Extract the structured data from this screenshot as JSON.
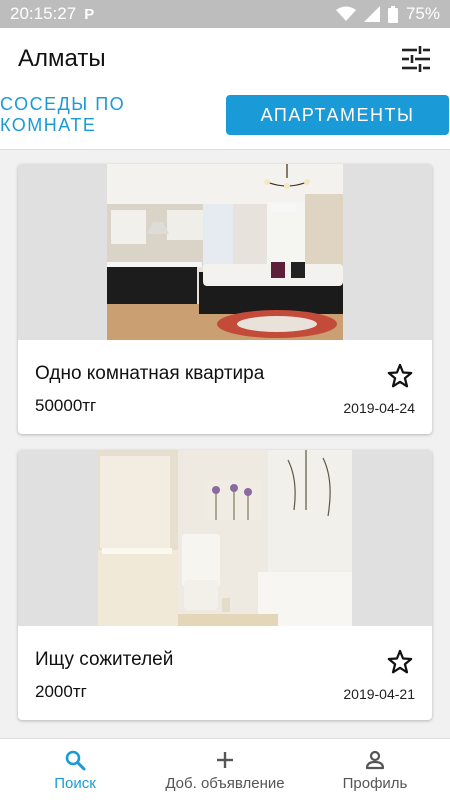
{
  "status_bar": {
    "time": "20:15:27",
    "app_indicator": "P",
    "battery": "75%"
  },
  "app_bar": {
    "title": "Алматы",
    "filter_icon": "tune-icon"
  },
  "tabs": [
    {
      "label": "СОСЕДЫ ПО КОМНАТЕ",
      "active": false
    },
    {
      "label": "АПАРТАМЕНТЫ",
      "active": true
    }
  ],
  "listings": [
    {
      "title": "Одно комнатная квартира",
      "price": "50000тг",
      "date": "2019-04-24",
      "photo": "living-room-kitchen"
    },
    {
      "title": "Ищу сожителей",
      "price": "2000тг",
      "date": "2019-04-21",
      "photo": "bathroom"
    }
  ],
  "bottom_nav": [
    {
      "label": "Поиск",
      "icon": "search-icon",
      "active": true
    },
    {
      "label": "Доб. объявление",
      "icon": "plus-icon",
      "active": false
    },
    {
      "label": "Профиль",
      "icon": "person-icon",
      "active": false
    }
  ],
  "colors": {
    "accent": "#1a9bd7",
    "status_bar": "#bdbdbd",
    "background": "#f1f1f1"
  }
}
